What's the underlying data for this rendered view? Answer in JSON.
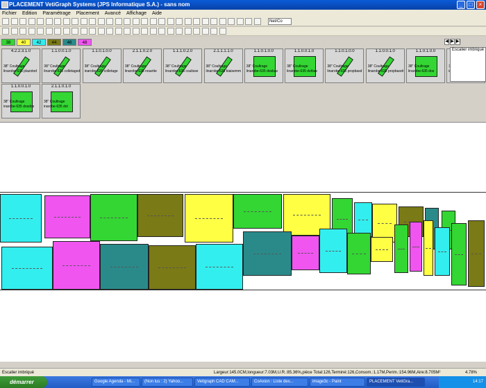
{
  "window": {
    "title": "PLACEMENT VetiGraph Systems (JPS Informatique S.A.) - sans nom",
    "minimize": "_",
    "maximize": "□",
    "close": "×"
  },
  "menu": [
    "Fichier",
    "Edition",
    "Paramétrage",
    "Placement",
    "Avancé",
    "Affichage",
    "Aide"
  ],
  "zoom_select": "Net/Co",
  "sizes": [
    {
      "label": "38",
      "color": "#33d633"
    },
    {
      "label": "40",
      "color": "#ffff44"
    },
    {
      "label": "42",
      "color": "#33eeee"
    },
    {
      "label": "44",
      "color": "#7a7a16"
    },
    {
      "label": "46",
      "color": "#2a8a8a"
    },
    {
      "label": "48",
      "color": "#f055f0"
    }
  ],
  "staircase_label": "Escalier imbriqué",
  "pieces": [
    {
      "code": "4.2.2.3.1.0",
      "label": "38\" Coultrage",
      "name": "linarobe-635 plazotod"
    },
    {
      "code": "1.1.0.0.1.0",
      "label": "38\" Coultrage",
      "name": "linarobe-635 colletagedepl"
    },
    {
      "code": "1.1.0.1.0.0",
      "label": "38\" Coultrage",
      "name": "inarobe-635 colletage"
    },
    {
      "code": "2.1.1.0.2.0",
      "label": "38\" Coultrage",
      "name": "linarobe-635 nouette"
    },
    {
      "code": "1.1.1.0.2.0",
      "label": "38\" Coultrage",
      "name": "linarobe-635 coulisse"
    },
    {
      "code": "2.1.1.1.1.0",
      "label": "38\" Coultrage",
      "name": "linarobe-635 biaisemm"
    },
    {
      "code": "1.1.0.1.0.0",
      "label": "38\" Coultrage",
      "name": "linarobe-635 dosbas"
    },
    {
      "code": "1.1.0.0.1.0",
      "label": "38\" Coultrage",
      "name": "linarobe-635 dvtbas"
    },
    {
      "code": "1.1.0.1.0.0",
      "label": "38\" Coultrage",
      "name": "linarobe-635 propbasd"
    },
    {
      "code": "1.1.0.0.1.0",
      "label": "38\" Coultrage",
      "name": "linarobe-635 propbasdr"
    },
    {
      "code": "1.1.0.1.0.0",
      "label": "38\" Coultrage",
      "name": "linarobe-635 dos"
    },
    {
      "code": "",
      "label": "38\" Coultrage",
      "name": "inarobe-635 propbasdr"
    },
    {
      "code": "1.1.0.0.1.0",
      "label": "38\" Coultrage",
      "name": "inarobe-635 dosdos"
    },
    {
      "code": "2.1.1.0.1.0",
      "label": "38\" Coultrage",
      "name": "inarobe-635 dvt"
    }
  ],
  "status": {
    "left": "Escalier imbriqué",
    "info": "Largeur:145.0CM,longueur:7.03M,U.R.:85.36%,pièce Total:126,Terminé:126,Consom.:1.17M,Perim.:154.96M,Aire:8.705M²",
    "percent": "4.78%"
  },
  "taskbar": {
    "start": "démarrer",
    "tasks": [
      "Google Agenda - Mi...",
      "(Non lus : 2) Yahoo...",
      "Vetigraph CAD CAM...",
      "CoAxion : Liste des...",
      "image3c - Paint",
      "PLACEMENT VetiGra..."
    ],
    "clock": "14:17"
  }
}
